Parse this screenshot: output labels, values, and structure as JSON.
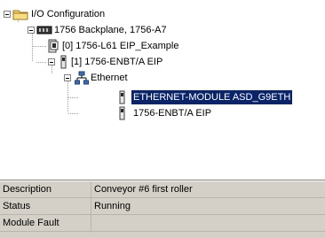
{
  "tree": {
    "root_label": "I/O Configuration",
    "backplane_label": "1756 Backplane, 1756-A7",
    "slot0_label": "[0] 1756-L61 EIP_Example",
    "slot1_label": "[1] 1756-ENBT/A EIP",
    "ethernet_label": "Ethernet",
    "module1_label": "ETHERNET-MODULE ASD_G9ETH",
    "module2_label": "1756-ENBT/A EIP"
  },
  "properties": {
    "rows": [
      {
        "key": "Description",
        "value": "Conveyor #6 first roller"
      },
      {
        "key": "Status",
        "value": "Running"
      },
      {
        "key": "Module Fault",
        "value": ""
      }
    ]
  },
  "colors": {
    "selection": "#0a246a",
    "panel": "#d4d0c8"
  }
}
